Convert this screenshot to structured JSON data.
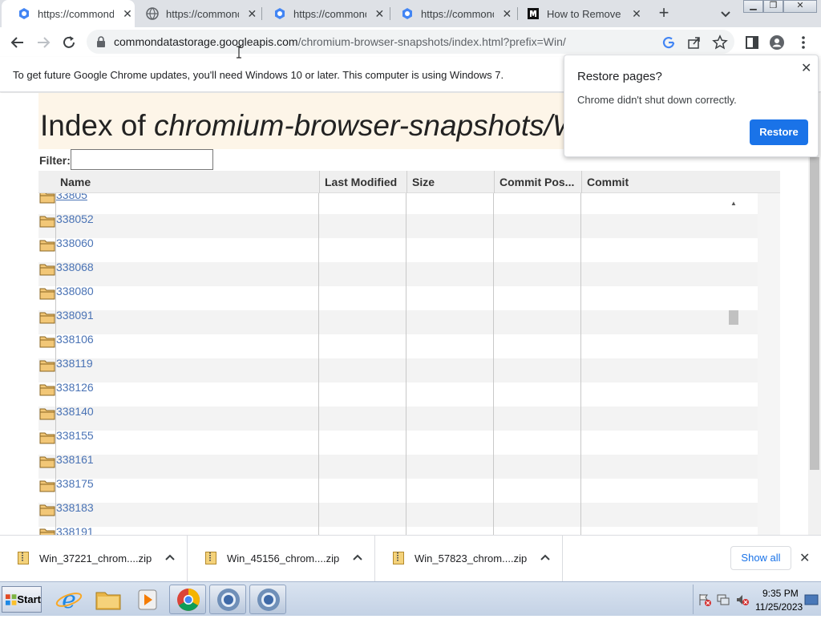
{
  "browser": {
    "tabs": [
      {
        "title": "https://commond",
        "active": true
      },
      {
        "title": "https://commond",
        "active": false
      },
      {
        "title": "https://commond",
        "active": false
      },
      {
        "title": "https://commond",
        "active": false
      },
      {
        "title": "How to Remove C",
        "active": false
      }
    ],
    "address": {
      "host": "commondatastorage.googleapis.com",
      "path": "/chromium-browser-snapshots/index.html?prefix=Win/"
    },
    "infobar": "To get future Google Chrome updates, you'll need Windows 10 or later. This computer is using Windows 7."
  },
  "page": {
    "heading_prefix": "Index of ",
    "heading_path": "chromium-browser-snapshots/W",
    "filter_label": "Filter:",
    "columns": [
      "Name",
      "Last Modified",
      "Size",
      "Commit Pos...",
      "Commit"
    ],
    "rows": [
      "33805",
      "338052",
      "338060",
      "338068",
      "338080",
      "338091",
      "338106",
      "338119",
      "338126",
      "338140",
      "338155",
      "338161",
      "338175",
      "338183",
      "338191"
    ]
  },
  "restore_popup": {
    "title": "Restore pages?",
    "message": "Chrome didn't shut down correctly.",
    "button": "Restore"
  },
  "downloads": {
    "items": [
      "Win_37221_chrom....zip",
      "Win_45156_chrom....zip",
      "Win_57823_chrom....zip"
    ],
    "show_all": "Show all"
  },
  "taskbar": {
    "start_label": "Start",
    "time": "9:35 PM",
    "date": "11/25/2023"
  },
  "colors": {
    "accent": "#1a73e8",
    "link": "#4a73b5",
    "heading_bg": "#fdf5e8"
  }
}
